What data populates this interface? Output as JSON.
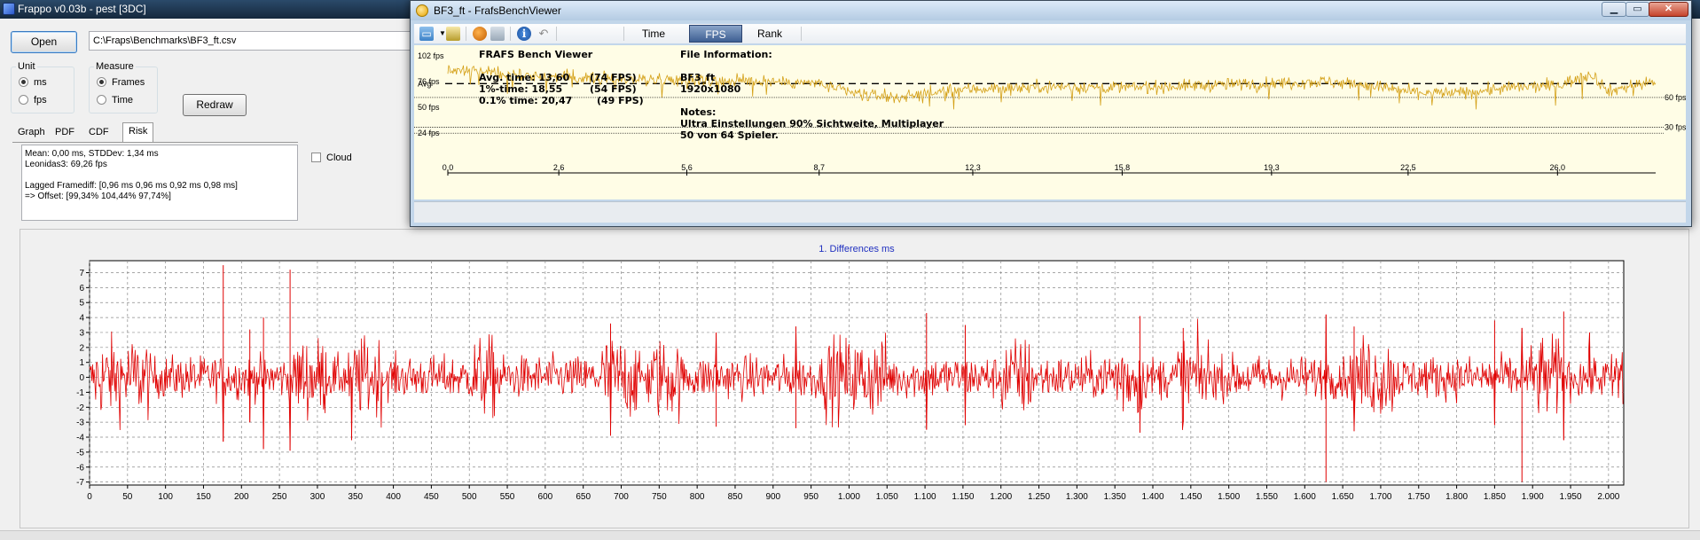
{
  "main": {
    "title": "Frappo v0.03b - pest [3DC]",
    "open_label": "Open",
    "file_path": "C:\\Fraps\\Benchmarks\\BF3_ft.csv",
    "unit": {
      "label": "Unit",
      "options": [
        "ms",
        "fps"
      ],
      "selected": "ms"
    },
    "measure": {
      "label": "Measure",
      "options": [
        "Frames",
        "Time"
      ],
      "selected": "Frames"
    },
    "redraw_label": "Redraw",
    "tabs": [
      "Graph",
      "PDF",
      "CDF",
      "Risk"
    ],
    "active_tab": "Risk",
    "stats_lines": [
      "Mean: 0,00 ms, STDDev: 1,34 ms",
      "Leonidas3: 69,26 fps",
      "",
      "Lagged Framediff: [0,96 ms 0,96 ms 0,92 ms 0,98 ms]",
      "=> Offset: [99,34% 104,44% 97,74%]"
    ],
    "cloud_label": "Cloud",
    "cloud_checked": false
  },
  "viewer": {
    "title": "BF3_ft - FrafsBenchViewer",
    "window_controls": [
      "▁",
      "▭",
      "✕"
    ],
    "toolbar_icons": [
      "folder-open-icon",
      "save-image-icon",
      "palette-icon",
      "copy-icon",
      "info-icon",
      "undo-icon"
    ],
    "tabs": [
      "Time",
      "FPS",
      "Rank"
    ],
    "active_tab": "FPS",
    "bench_title": "FRAFS Bench Viewer",
    "avg_line": "Avg. time: 13,60",
    "avg_fps": "(74 FPS)",
    "p1_line": "1%-time: 18,55",
    "p1_fps": "(54 FPS)",
    "p01_line": "0.1% time: 20,47",
    "p01_fps": "(49 FPS)",
    "file_info_label": "File Information:",
    "file_name": "BF3_ft",
    "resolution": "1920x1080",
    "notes_label": "Notes:",
    "notes_lines": [
      "Ultra Einstellungen 90% Sichtweite, Multiplayer",
      "50 von 64 Spieler."
    ]
  },
  "colors": {
    "diff_line": "#e00000",
    "fps_line": "#d4a017",
    "chart_title": "#2030c0",
    "viewer_bg": "#fffde6"
  },
  "chart_data": [
    {
      "type": "line",
      "title": "1. Differences ms",
      "xlim": [
        0,
        2020
      ],
      "ylim": [
        -7.2,
        7.8
      ],
      "x_tick_labels": [
        "0",
        "50",
        "100",
        "150",
        "200",
        "250",
        "300",
        "350",
        "400",
        "450",
        "500",
        "550",
        "600",
        "650",
        "700",
        "750",
        "800",
        "850",
        "900",
        "950",
        "1.000",
        "1.050",
        "1.100",
        "1.150",
        "1.200",
        "1.250",
        "1.300",
        "1.350",
        "1.400",
        "1.450",
        "1.500",
        "1.550",
        "1.600",
        "1.650",
        "1.700",
        "1.750",
        "1.800",
        "1.850",
        "1.900",
        "1.950",
        "2.000"
      ],
      "y_tick_labels": [
        "7",
        "6",
        "5",
        "4",
        "3",
        "2",
        "1",
        "0",
        "-1",
        "-2",
        "-3",
        "-4",
        "-5",
        "-6",
        "-7"
      ],
      "grid": true,
      "series": [
        {
          "color": "#e00000",
          "n_points": 2020,
          "amplitude_typical": 1.3,
          "spikes": [
            [
              176,
              7.5
            ],
            [
              176,
              -4.3
            ],
            [
              264,
              7.2
            ],
            [
              264,
              -4.9
            ],
            [
              229,
              4.0
            ],
            [
              229,
              -4.8
            ],
            [
              345,
              -4.2
            ],
            [
              1628,
              -7.0
            ],
            [
              1628,
              4.2
            ],
            [
              1665,
              3.4
            ],
            [
              1665,
              -3.6
            ],
            [
              1886,
              -7.0
            ],
            [
              1886,
              3.3
            ],
            [
              1941,
              4.4
            ],
            [
              1941,
              -4.2
            ],
            [
              1102,
              4.3
            ],
            [
              1102,
              -3.5
            ],
            [
              1153,
              3.5
            ],
            [
              1153,
              -3.2
            ],
            [
              1383,
              4.1
            ],
            [
              1383,
              -3.7
            ],
            [
              930,
              -3.4
            ],
            [
              930,
              3.4
            ],
            [
              825,
              -3.3
            ],
            [
              825,
              3.0
            ],
            [
              1440,
              3.3
            ],
            [
              1440,
              -3.0
            ],
            [
              1850,
              3.8
            ],
            [
              1850,
              -3.2
            ],
            [
              686,
              3.6
            ],
            [
              686,
              -3.9
            ],
            [
              211,
              3.2
            ],
            [
              211,
              -3.0
            ],
            [
              1975,
              3.0
            ]
          ]
        }
      ]
    },
    {
      "type": "line",
      "xlim": [
        0,
        28.3
      ],
      "ylim": [
        0,
        102
      ],
      "x_tick_labels": [
        "0,0",
        "2,6",
        "5,6",
        "8,7",
        "12,3",
        "15,8",
        "19,3",
        "22,5",
        "26,0"
      ],
      "x_tick_values": [
        0,
        2.6,
        5.6,
        8.7,
        12.3,
        15.8,
        19.3,
        22.5,
        26.0
      ],
      "y_tick_labels": [
        "102 fps",
        "76 fps",
        "Avg",
        "50 fps",
        "24 fps"
      ],
      "y_tick_values": [
        102,
        76,
        74,
        50,
        24
      ],
      "ref_lines": [
        {
          "label": "60 fps",
          "value": 60
        },
        {
          "label": "30 fps",
          "value": 30
        }
      ],
      "avg_value": 74,
      "series": [
        {
          "color": "#d4a017",
          "n_points": 1400,
          "keypoints": [
            [
              0,
              88
            ],
            [
              1.5,
              84
            ],
            [
              3.0,
              80
            ],
            [
              5.0,
              78
            ],
            [
              7.5,
              76
            ],
            [
              8.7,
              74
            ],
            [
              9.5,
              64
            ],
            [
              10.5,
              60
            ],
            [
              12.0,
              68
            ],
            [
              14.0,
              71
            ],
            [
              16.0,
              70
            ],
            [
              17.5,
              72
            ],
            [
              19.0,
              74
            ],
            [
              20.5,
              76
            ],
            [
              21.5,
              73
            ],
            [
              22.5,
              66
            ],
            [
              23.5,
              64
            ],
            [
              25.0,
              70
            ],
            [
              26.0,
              72
            ],
            [
              26.8,
              84
            ],
            [
              27.2,
              66
            ],
            [
              27.8,
              73
            ],
            [
              28.3,
              76
            ]
          ]
        }
      ]
    }
  ]
}
